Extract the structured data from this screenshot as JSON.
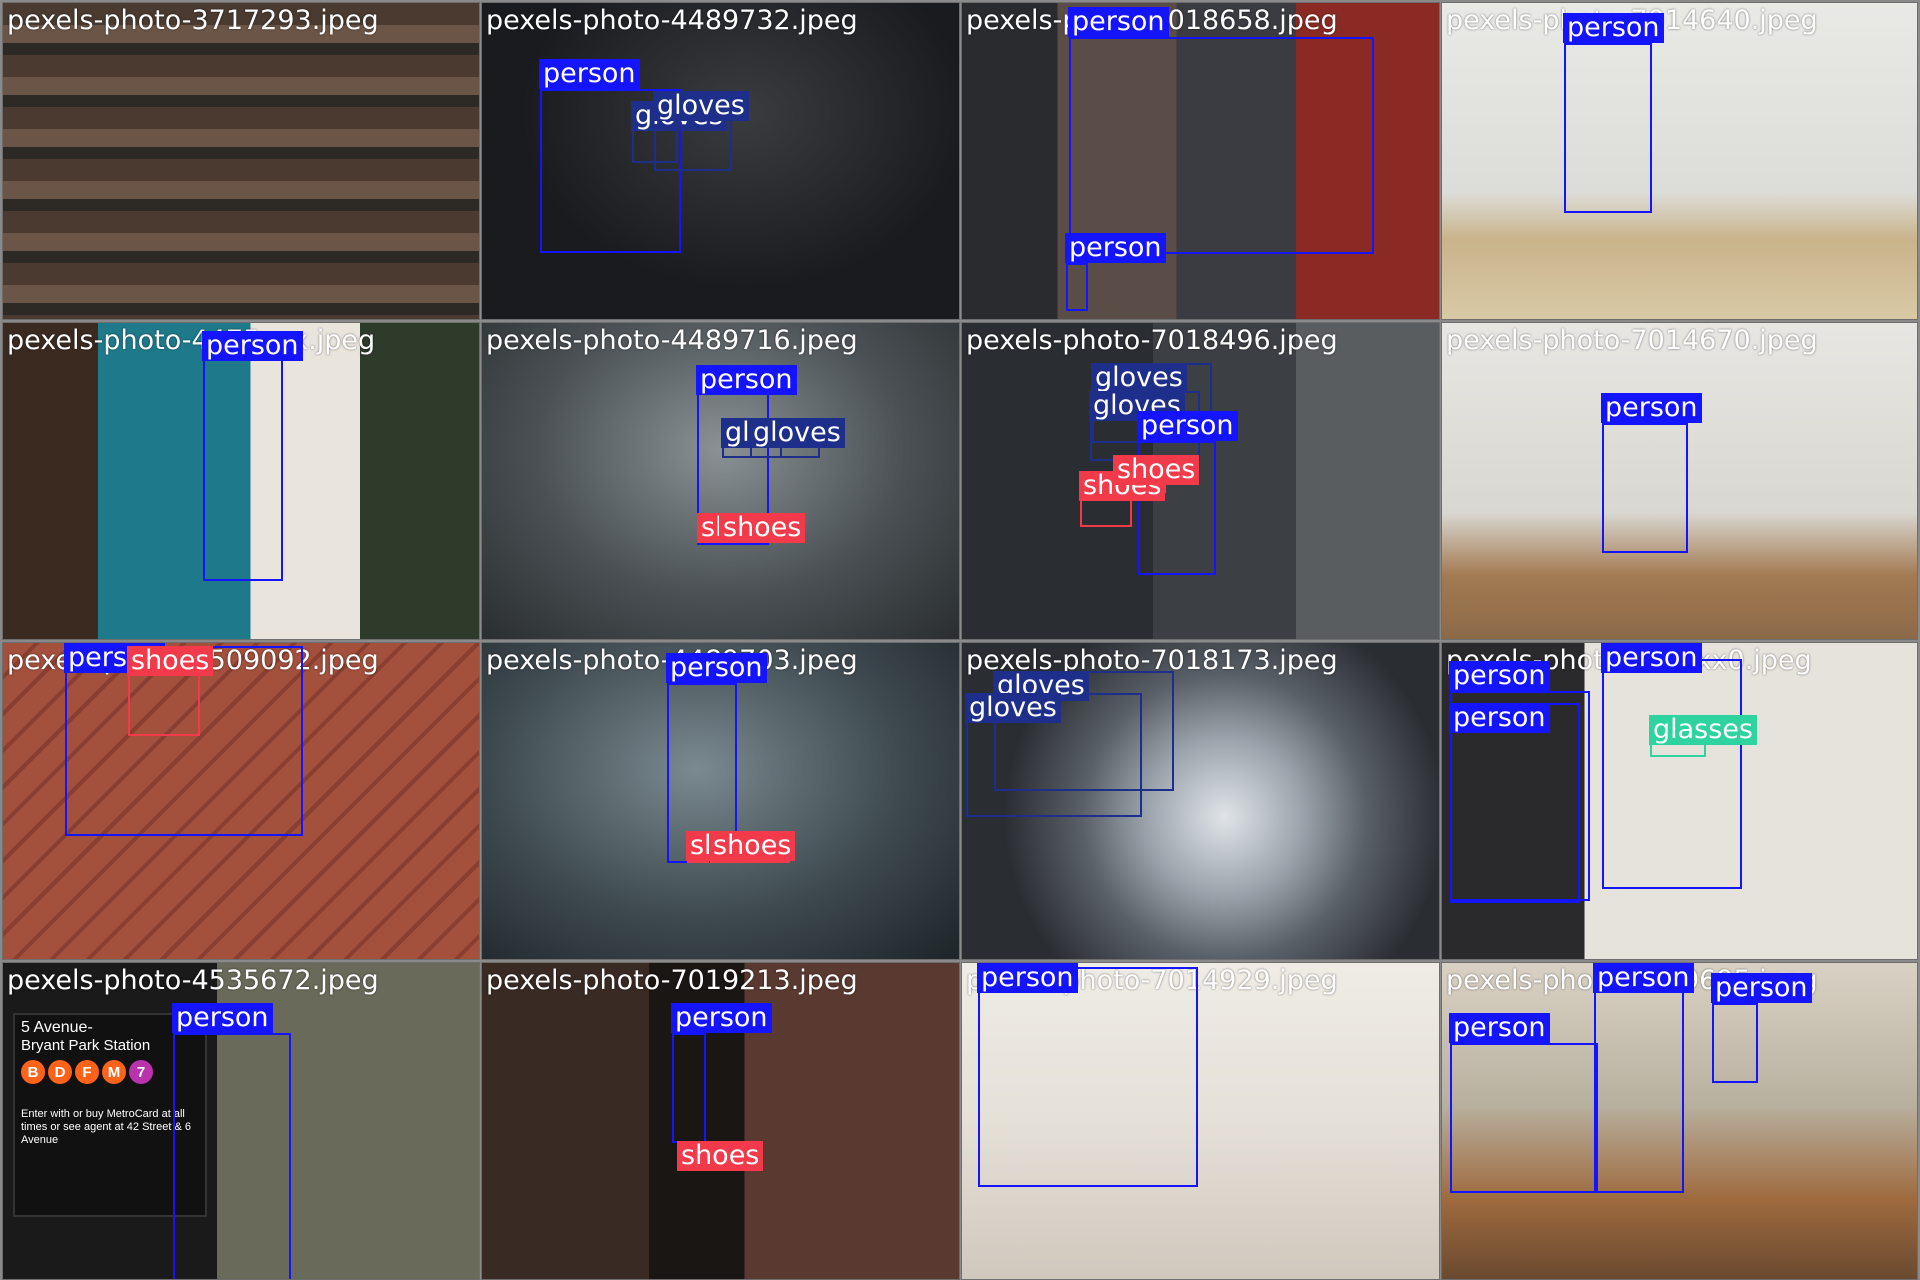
{
  "classes": {
    "person": {
      "color": "#1414ff",
      "text": "#ffffff"
    },
    "gloves": {
      "color": "#1d2f8a",
      "text": "#ffffff"
    },
    "shoes": {
      "color": "#f23a4a",
      "text": "#ffffff"
    },
    "glasses": {
      "color": "#2fd3a0",
      "text": "#ffffff"
    }
  },
  "tiles": [
    {
      "filename": "pexels-photo-3717293.jpeg",
      "scene": "building-facade",
      "detections": []
    },
    {
      "filename": "pexels-photo-4489732.jpeg",
      "scene": "garage",
      "detections": [
        {
          "label": "person"
        },
        {
          "label": "gloves"
        },
        {
          "label": "gloves"
        }
      ]
    },
    {
      "filename": "pexels-photo-7018658.jpeg",
      "scene": "warehouse-woman",
      "detections": [
        {
          "label": "person"
        },
        {
          "label": "person"
        }
      ]
    },
    {
      "filename": "pexels-photo-7014640.jpeg",
      "scene": "studio-photographer",
      "detections": [
        {
          "label": "person"
        }
      ]
    },
    {
      "filename": "pexels-photo-4475xxx.jpeg",
      "scene": "blue-door",
      "detections": [
        {
          "label": "person"
        }
      ]
    },
    {
      "filename": "pexels-photo-4489716.jpeg",
      "scene": "foggy-garage",
      "detections": [
        {
          "label": "person"
        },
        {
          "label": "gloves"
        },
        {
          "label": "gloves"
        },
        {
          "label": "shoes"
        },
        {
          "label": "shoes"
        }
      ]
    },
    {
      "filename": "pexels-photo-7018496.jpeg",
      "scene": "mechanic-legs",
      "detections": [
        {
          "label": "gloves"
        },
        {
          "label": "gloves"
        },
        {
          "label": "person"
        },
        {
          "label": "shoes"
        },
        {
          "label": "shoes"
        }
      ]
    },
    {
      "filename": "pexels-photo-7014670.jpeg",
      "scene": "bright-room",
      "detections": [
        {
          "label": "person"
        }
      ]
    },
    {
      "filename": "pexels-photo-4509092.jpeg",
      "scene": "brick-laying",
      "detections": [
        {
          "label": "person"
        },
        {
          "label": "shoes"
        }
      ]
    },
    {
      "filename": "pexels-photo-4489703.jpeg",
      "scene": "foggy-garage-2",
      "detections": [
        {
          "label": "person"
        },
        {
          "label": "shoes"
        },
        {
          "label": "shoes"
        }
      ]
    },
    {
      "filename": "pexels-photo-7018173.jpeg",
      "scene": "disc-brake",
      "detections": [
        {
          "label": "gloves"
        },
        {
          "label": "gloves"
        }
      ]
    },
    {
      "filename": "pexels-photo-7xxxxx0.jpeg",
      "scene": "call-center",
      "detections": [
        {
          "label": "person"
        },
        {
          "label": "person"
        },
        {
          "label": "person"
        },
        {
          "label": "glasses"
        }
      ]
    },
    {
      "filename": "pexels-photo-4535672.jpeg",
      "scene": "subway-street",
      "detections": [
        {
          "label": "person"
        }
      ],
      "sign_line1": "5 Avenue-",
      "sign_line2": "Bryant Park Station",
      "sign_routes": [
        "B",
        "D",
        "F",
        "M",
        "7"
      ],
      "sign_notice": "Enter with or buy MetroCard at all times or see agent at 42 Street & 6 Avenue"
    },
    {
      "filename": "pexels-photo-7019213.jpeg",
      "scene": "storage-aisle",
      "detections": [
        {
          "label": "person"
        },
        {
          "label": "shoes"
        }
      ]
    },
    {
      "filename": "pexels-photo-7014929.jpeg",
      "scene": "desk-laptop",
      "detections": [
        {
          "label": "person"
        }
      ]
    },
    {
      "filename": "pexels-photo-5409695.jpeg",
      "scene": "flower-shop",
      "detections": [
        {
          "label": "person"
        },
        {
          "label": "person"
        },
        {
          "label": "person"
        }
      ]
    }
  ]
}
